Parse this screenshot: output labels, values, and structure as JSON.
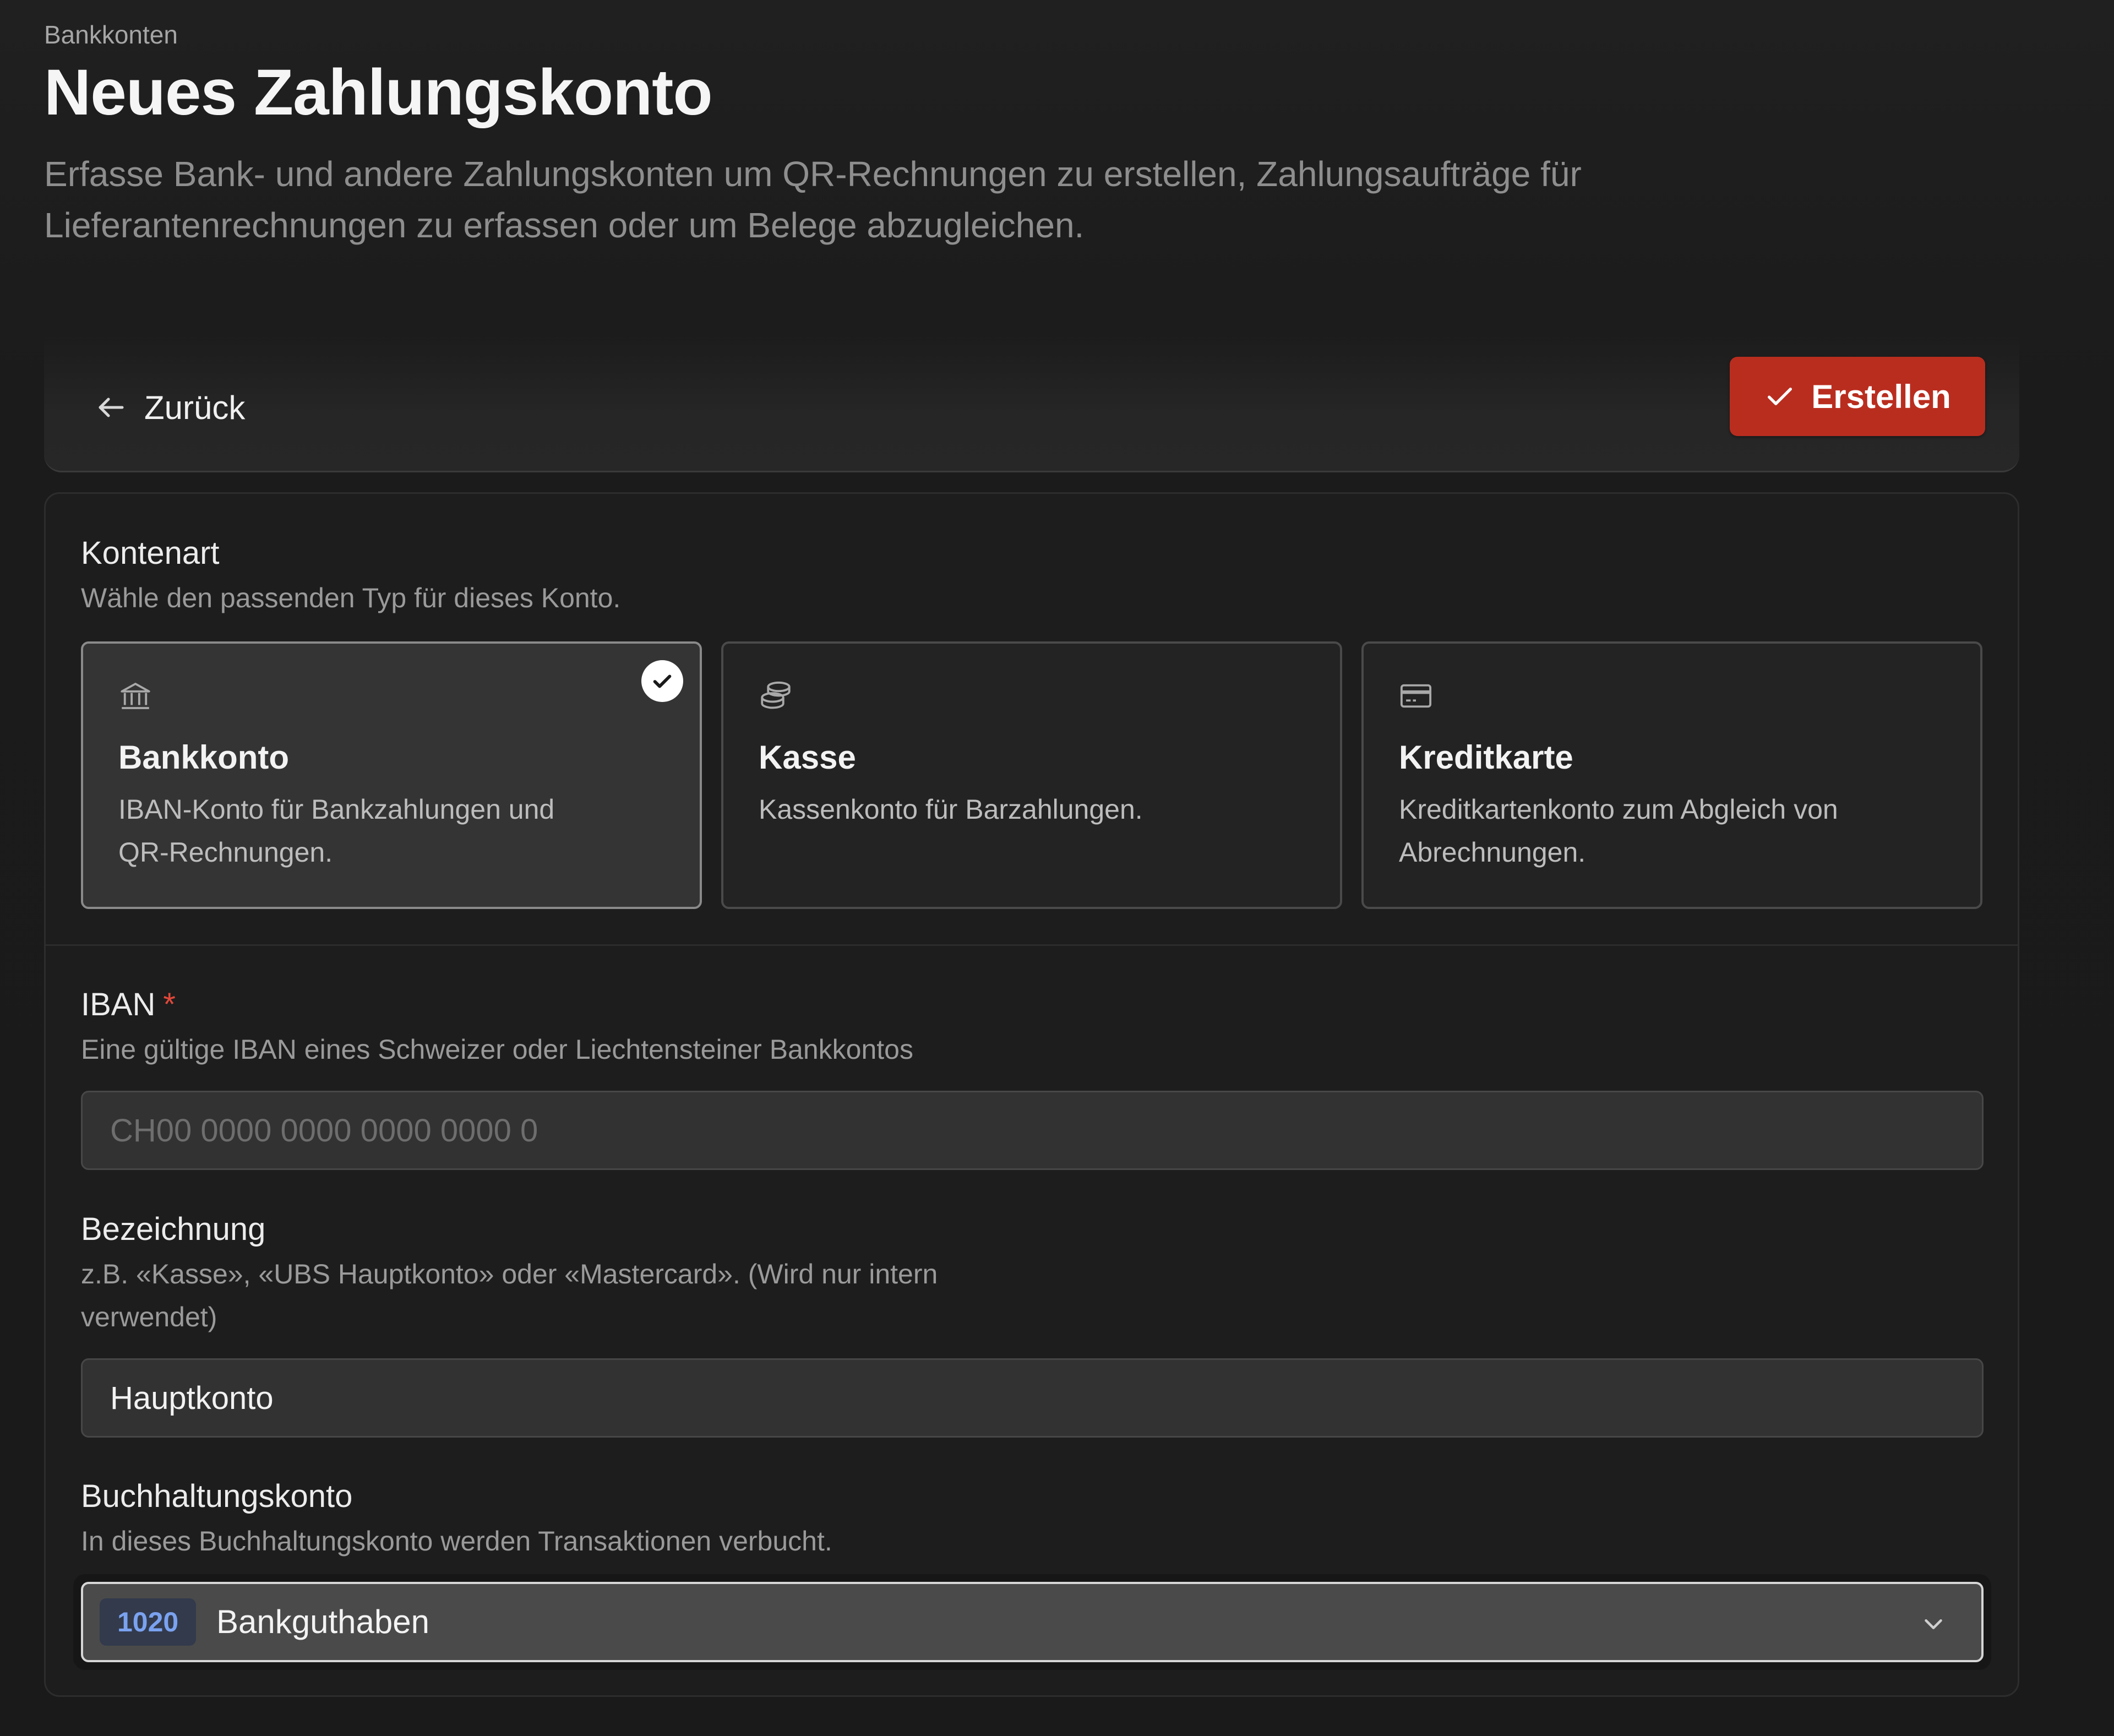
{
  "breadcrumb": "Bankkonten",
  "title": "Neues Zahlungskonto",
  "description": "Erfasse Bank- und andere Zahlungskonten um QR-Rechnungen zu erstellen, Zahlungsaufträge für Lieferantenrechnungen zu erfassen oder um Belege abzugleichen.",
  "toolbar": {
    "back_label": "Zurück",
    "create_label": "Erstellen",
    "accent_color": "#b92d1f"
  },
  "account_type": {
    "title": "Kontenart",
    "help": "Wähle den passenden Typ für dieses Konto.",
    "options": [
      {
        "title": "Bankkonto",
        "description": "IBAN-Konto für Bankzahlungen und QR-Rechnungen.",
        "icon": "bank-icon",
        "selected": true
      },
      {
        "title": "Kasse",
        "description": "Kassenkonto für Barzahlungen.",
        "icon": "coins-icon",
        "selected": false
      },
      {
        "title": "Kreditkarte",
        "description": "Kreditkartenkonto zum Abgleich von Abrechnungen.",
        "icon": "credit-card-icon",
        "selected": false
      }
    ]
  },
  "iban": {
    "label": "IBAN",
    "required_mark": "*",
    "help": "Eine gültige IBAN eines Schweizer oder Liechtensteiner Bankkontos",
    "placeholder": "CH00 0000 0000 0000 0000 0",
    "value": ""
  },
  "designation": {
    "label": "Bezeichnung",
    "help": "z.B. «Kasse», «UBS Hauptkonto» oder «Mastercard». (Wird nur intern verwendet)",
    "value": "Hauptkonto"
  },
  "accounting_account": {
    "label": "Buchhaltungskonto",
    "help": "In dieses Buchhaltungskonto werden Transaktionen verbucht.",
    "account_number": "1020",
    "account_name": "Bankguthaben"
  }
}
